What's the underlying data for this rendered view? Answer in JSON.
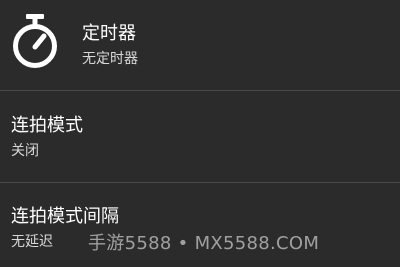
{
  "settings": {
    "items": [
      {
        "icon": "timer-icon",
        "title": "定时器",
        "value": "无定时器"
      },
      {
        "title": "连拍模式",
        "value": "关闭"
      },
      {
        "title": "连拍模式间隔",
        "value": "无延迟"
      }
    ]
  },
  "watermark": "手游5588 • MX5588.COM",
  "colors": {
    "background": "#2b2b2b",
    "divider": "#4a4a4a",
    "text_primary": "#ffffff",
    "text_secondary": "#d8d8d8"
  }
}
